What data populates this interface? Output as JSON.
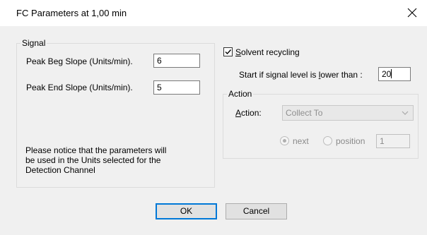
{
  "window": {
    "title": "FC Parameters at 1,00 min"
  },
  "signal_group": {
    "label": "Signal",
    "peak_beg_label": "Peak Beg Slope (Units/min).",
    "peak_beg_value": "6",
    "peak_end_label": "Peak End Slope (Units/min).",
    "peak_end_value": "5",
    "notice_line1": "Please notice that the parameters will",
    "notice_line2": "be used in the Units selected for the",
    "notice_line3": "Detection Channel"
  },
  "solvent": {
    "checkbox_label_first": "S",
    "checkbox_label_rest": "olvent recycling",
    "checked": true,
    "start_label_pre": "Start if signal level is ",
    "start_label_acc": "l",
    "start_label_post": "ower than :",
    "start_value": "20"
  },
  "action_group": {
    "label": "Action",
    "action_label_first": "A",
    "action_label_rest": "ction:",
    "action_selected": "Collect To",
    "radio_next_label": "next",
    "radio_position_label": "position",
    "position_value": "1",
    "next_selected": true
  },
  "buttons": {
    "ok": "OK",
    "cancel": "Cancel"
  }
}
